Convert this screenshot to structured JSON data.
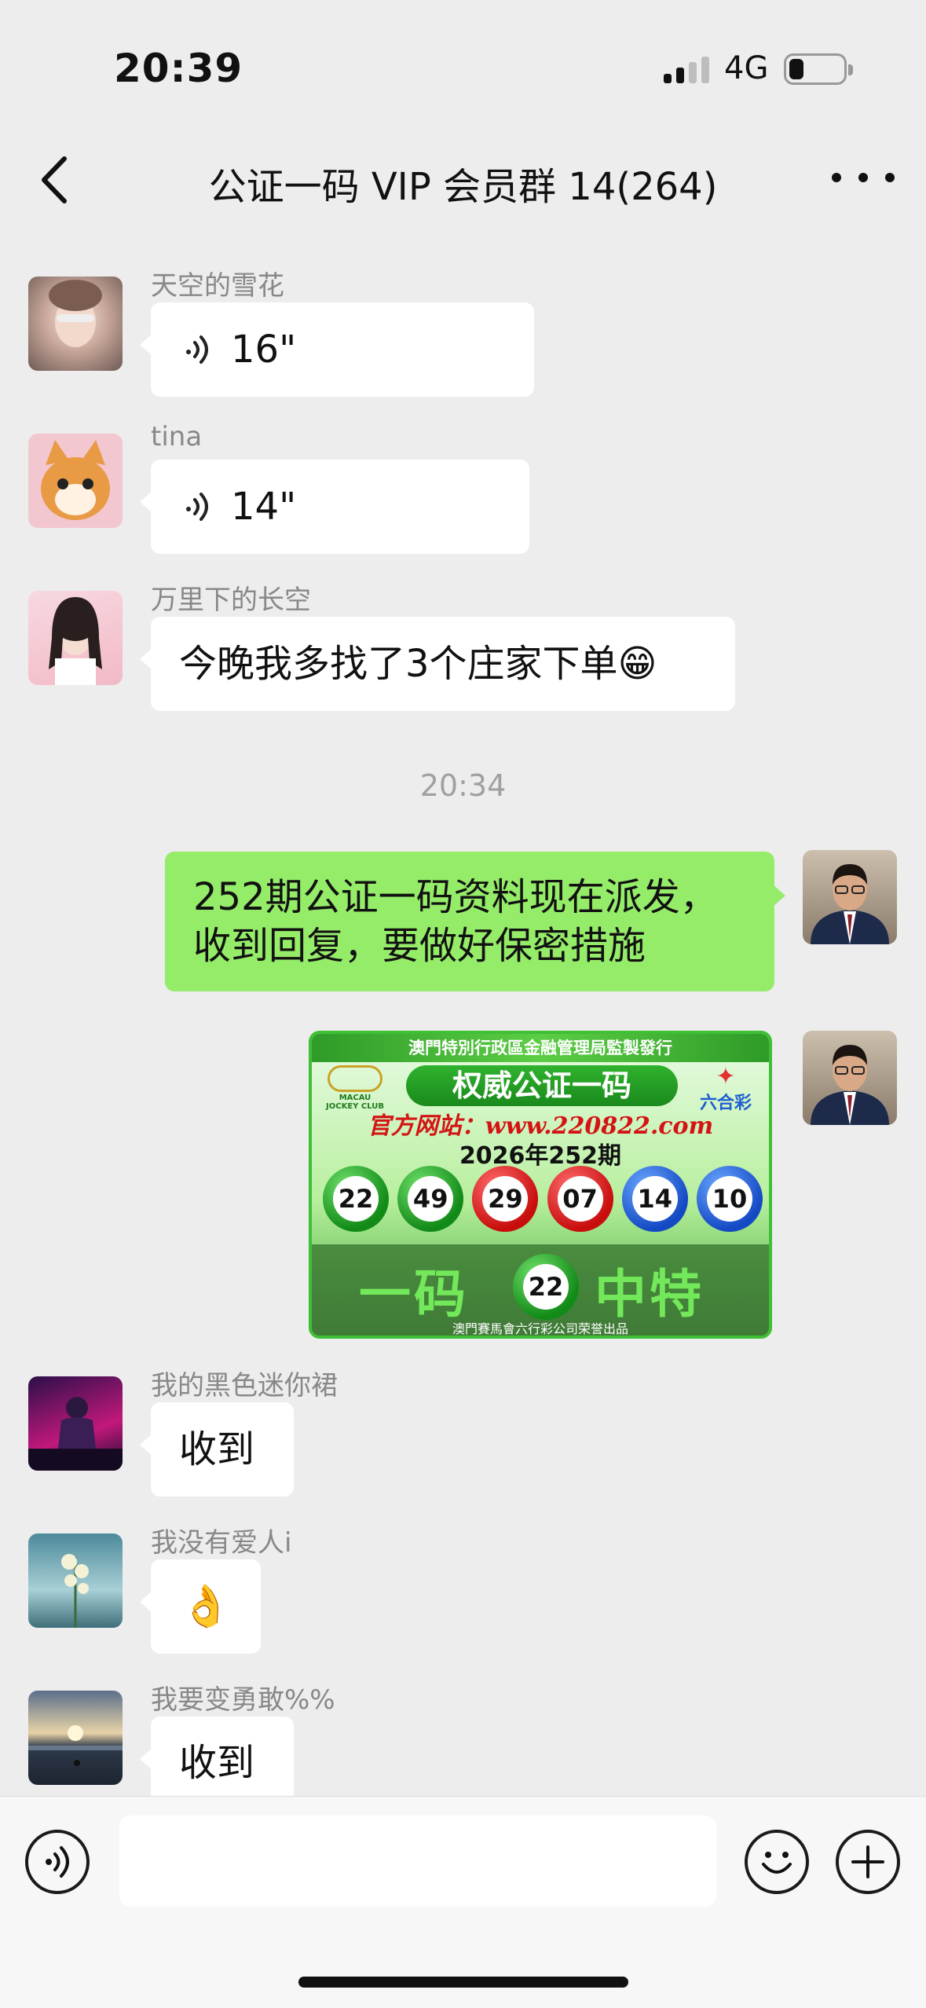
{
  "status_bar": {
    "time": "20:39",
    "network": "4G",
    "signal_bars": 2,
    "battery_level": 0.2
  },
  "nav": {
    "title": "公证一码 VIP 会员群 14(264)"
  },
  "messages": [
    {
      "sender": "天空的雪花",
      "type": "voice",
      "duration": "16\""
    },
    {
      "sender": "tina",
      "type": "voice",
      "duration": "14\""
    },
    {
      "sender": "万里下的长空",
      "type": "text",
      "text": "今晚我多找了3个庄家下单😁"
    },
    {
      "type": "time",
      "text": "20:34"
    },
    {
      "sender": "self",
      "type": "text",
      "text_line1": "252期公证一码资料现在派发，",
      "text_line2": "收到回复，要做好保密措施"
    },
    {
      "sender": "self",
      "type": "image"
    },
    {
      "sender": "我的黑色迷你裙",
      "type": "text",
      "text": "收到"
    },
    {
      "sender": "我没有爱人i",
      "type": "emoji",
      "text": "👌"
    },
    {
      "sender": "我要变勇敢%%",
      "type": "text",
      "text": "收到"
    }
  ],
  "lottery_image": {
    "header": "澳門特別行政區金融管理局監製發行",
    "logo_left": "MACAU JOCKEY CLUB",
    "logo_right": "六合彩",
    "title": "权威公证一码",
    "site": "官方网站：www.220822.com",
    "period": "2026年252期",
    "balls": [
      {
        "number": "22",
        "color": "green"
      },
      {
        "number": "49",
        "color": "green"
      },
      {
        "number": "29",
        "color": "red"
      },
      {
        "number": "07",
        "color": "red"
      },
      {
        "number": "14",
        "color": "blue"
      },
      {
        "number": "10",
        "color": "blue"
      }
    ],
    "bottom_left": "一码",
    "special_number": "22",
    "bottom_right": "中特",
    "footer": "澳門賽馬會六行彩公司荣誉出品"
  },
  "colors": {
    "background": "#ededed",
    "self_bubble": "#95ec69",
    "other_bubble": "#ffffff"
  },
  "icons": [
    "back-arrow-icon",
    "more-icon",
    "voice-wave-icon",
    "voice-input-icon",
    "emoji-icon",
    "plus-icon"
  ]
}
